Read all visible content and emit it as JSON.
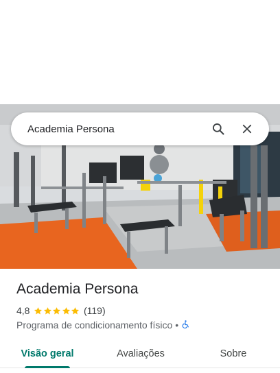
{
  "search": {
    "query": "Academia Persona"
  },
  "icons": {
    "search": "search-icon",
    "close": "close-icon",
    "star": "star-icon",
    "accessibility": "wheelchair-icon"
  },
  "place": {
    "name": "Academia Persona",
    "rating": "4,8",
    "stars": 5,
    "reviews": "(119)",
    "category": "Programa de condicionamento físico",
    "separator": "•"
  },
  "tabs": [
    {
      "label": "Visão geral",
      "active": true
    },
    {
      "label": "Avaliações",
      "active": false
    },
    {
      "label": "Sobre",
      "active": false
    }
  ],
  "colors": {
    "accent": "#00796b",
    "star": "#fbbc04",
    "floor_orange": "#e8651f",
    "accessibility_blue": "#1a73e8"
  }
}
